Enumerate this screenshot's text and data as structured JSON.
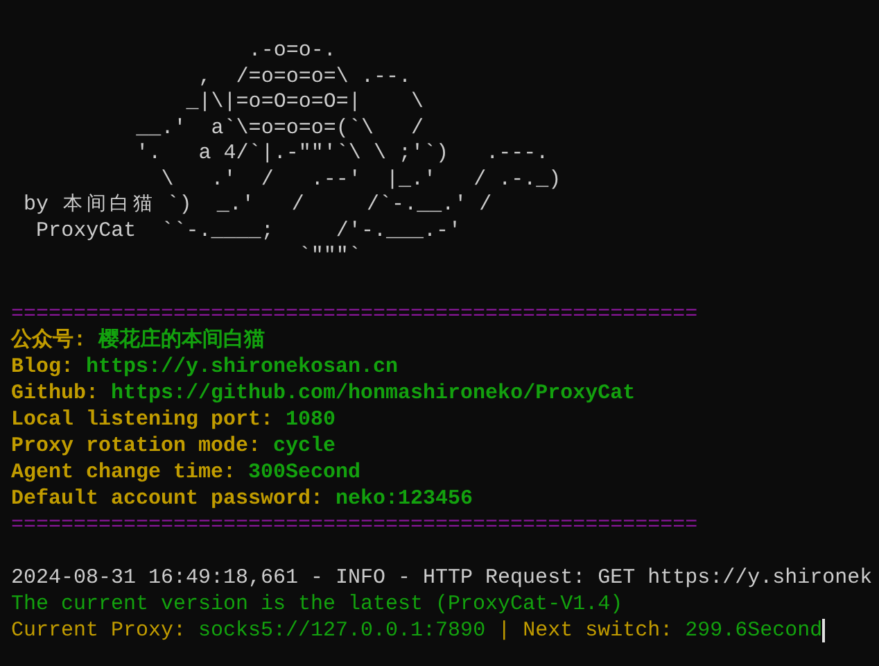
{
  "banner": {
    "art_lines": [
      "                   .-o=o-.",
      "               ,  /=o=o=o=\\ .--.",
      "              _|\\|=o=O=o=O=|    \\",
      "          __.'  a`\\=o=o=o=(`\\   /",
      "          '.   a 4/`|.-\"\"'`\\ \\ ;'`)   .---.",
      "            \\   .'  /   .--'  |_.'   / .-._)",
      " by 本间白猫 `)  _.'   /     /`-.__.' /",
      "  ProxyCat  ``-.____;     /'-.___.-'",
      "                       `\"\"\"`"
    ]
  },
  "separator_top": "=======================================================",
  "info_lines": [
    {
      "label": "公众号:",
      "value": "樱花庄的本间白猫"
    },
    {
      "label": "Blog:",
      "value": "https://y.shironekosan.cn"
    },
    {
      "label": "Github:",
      "value": "https://github.com/honmashironeko/ProxyCat"
    },
    {
      "label": "Local listening port:",
      "value": "1080"
    },
    {
      "label": "Proxy rotation mode:",
      "value": "cycle"
    },
    {
      "label": "Agent change time:",
      "value": "300Second"
    },
    {
      "label": "Default account password:",
      "value": "neko:123456"
    }
  ],
  "separator_bottom": "=======================================================",
  "log_lines": [
    {
      "segments": [
        {
          "kind": "plain",
          "text": "2024-08-31 16:49:18,661 - INFO - HTTP Request: GET https://y.shironek"
        }
      ]
    },
    {
      "segments": [
        {
          "kind": "value",
          "text": "The current version is the latest (ProxyCat-V1.4)"
        }
      ]
    },
    {
      "segments": [
        {
          "kind": "label",
          "text": "Current Proxy:"
        },
        {
          "kind": "value",
          "text": "socks5://127.0.0.1:7890"
        },
        {
          "kind": "label",
          "text": "|"
        },
        {
          "kind": "label",
          "text": "Next switch:"
        },
        {
          "kind": "value",
          "text": "299.6Second"
        }
      ]
    }
  ],
  "cursor": {
    "visible": true
  }
}
